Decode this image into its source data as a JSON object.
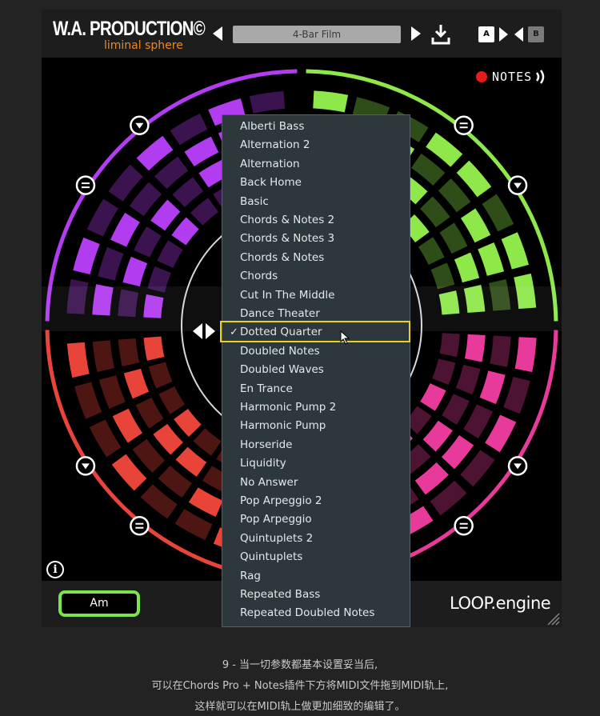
{
  "header": {
    "brand_title": "W.A. PRODUCTION©",
    "brand_subtitle": "liminal sphere",
    "preset_name": "4-Bar Film",
    "ab_a": "A",
    "ab_b": "B"
  },
  "notes_indicator": {
    "label": "NOTES"
  },
  "footer": {
    "key_label": "Am",
    "logo": "LOOP.engine"
  },
  "info_label": "i",
  "menu": {
    "selected": "Dotted Quarter",
    "check_mark": "✓",
    "items": [
      "Alberti Bass",
      "Alternation 2",
      "Alternation",
      "Back Home",
      "Basic",
      "Chords & Notes 2",
      "Chords & Notes 3",
      "Chords & Notes",
      "Chords",
      "Cut In The Middle",
      "Dance Theater",
      "Dotted Quarter",
      "Doubled Notes",
      "Doubled Waves",
      "En Trance",
      "Harmonic Pump 2",
      "Harmonic Pump",
      "Horseride",
      "Liquidity",
      "No Answer",
      "Pop Arpeggio 2",
      "Pop Arpeggio",
      "Quintuplets 2",
      "Quintuplets",
      "Rag",
      "Repeated Bass",
      "Repeated Doubled Notes"
    ]
  },
  "colors": {
    "purple": "#b23cf0",
    "green": "#8fe84a",
    "red": "#e8443a",
    "pink": "#e83a9a",
    "highlight": "#e9d21c",
    "key_border": "#7be34b"
  },
  "caption": {
    "line1": "9 - 当一切参数都基本设置妥当后,",
    "line2": "可以在Chords Pro + Notes插件下方将MIDI文件拖到MIDI轨上,",
    "line3": "这样就可以在MIDI轨上做更加细致的编辑了。"
  }
}
